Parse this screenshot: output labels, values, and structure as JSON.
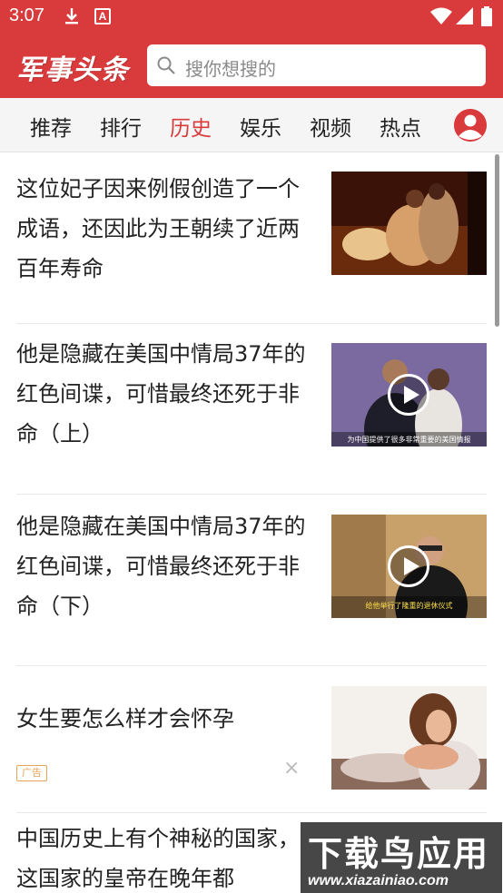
{
  "status_bar": {
    "time": "3:07",
    "a_badge": "A"
  },
  "header": {
    "logo": "军事头条",
    "search_placeholder": "搜你想搜的"
  },
  "tabs": [
    {
      "label": "推荐",
      "active": false
    },
    {
      "label": "排行",
      "active": false
    },
    {
      "label": "历史",
      "active": true
    },
    {
      "label": "娱乐",
      "active": false
    },
    {
      "label": "视频",
      "active": false
    },
    {
      "label": "热点",
      "active": false
    }
  ],
  "feed": [
    {
      "title": "这位妃子因来例假创造了一个成语，还因此为王朝续了近两百年寿命",
      "video": false
    },
    {
      "title": "他是隐藏在美国中情局37年的红色间谍，可惜最终还死于非命（上）",
      "video": true,
      "caption": "为中国提供了很多非常重要的美国情报"
    },
    {
      "title": "他是隐藏在美国中情局37年的红色间谍，可惜最终还死于非命（下）",
      "video": true,
      "caption": "给他举行了隆重的退休仪式"
    },
    {
      "title": "女生要怎么样才会怀孕",
      "ad_label": "广告",
      "ad_close": "×"
    },
    {
      "title": "中国历史上有个神秘的国家，这国家的皇帝在晚年都"
    }
  ],
  "watermark": {
    "big": "下载鸟应用",
    "small": "www.xiazainiao.com"
  },
  "colors": {
    "brand_red": "#d93a3c",
    "tab_bg": "#f5f5f5",
    "ad_orange": "#e8a45a"
  }
}
